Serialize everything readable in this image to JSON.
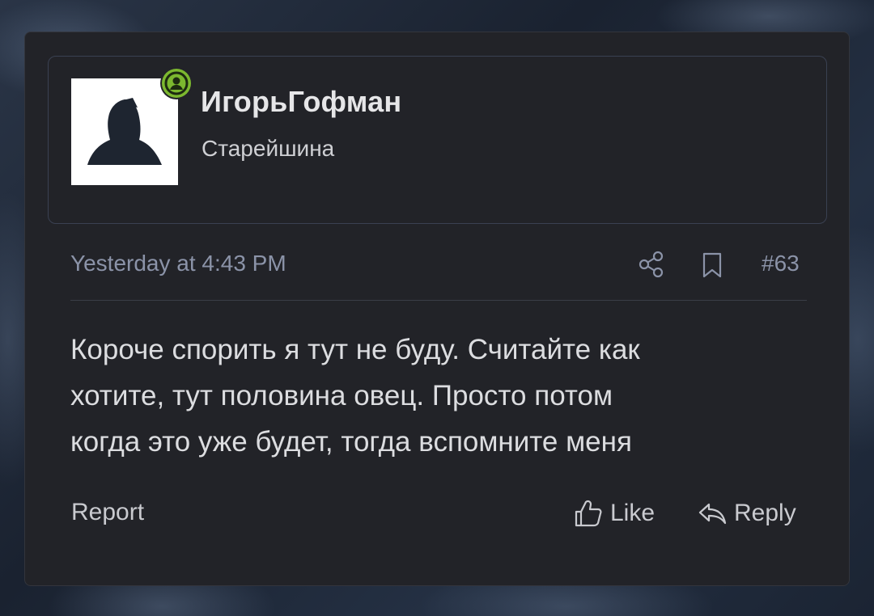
{
  "post": {
    "user": {
      "name": "ИгорьГофман",
      "title": "Старейшина",
      "avatar_icon": "hooded-figure-avatar",
      "online_badge_icon": "user-online-icon",
      "online_color": "#7cb82f"
    },
    "meta": {
      "timestamp": "Yesterday at 4:43 PM",
      "share_icon": "share-icon",
      "bookmark_icon": "bookmark-icon",
      "post_number": "#63"
    },
    "content": {
      "lines": [
        "Короче спорить я тут не буду. Считайте как",
        "хотите, тут половина овец. Просто потом",
        "когда это уже будет, тогда вспомните меня"
      ]
    },
    "actions": {
      "report_label": "Report",
      "like_label": "Like",
      "like_icon": "thumbs-up-icon",
      "reply_label": "Reply",
      "reply_icon": "reply-arrow-icon"
    }
  }
}
